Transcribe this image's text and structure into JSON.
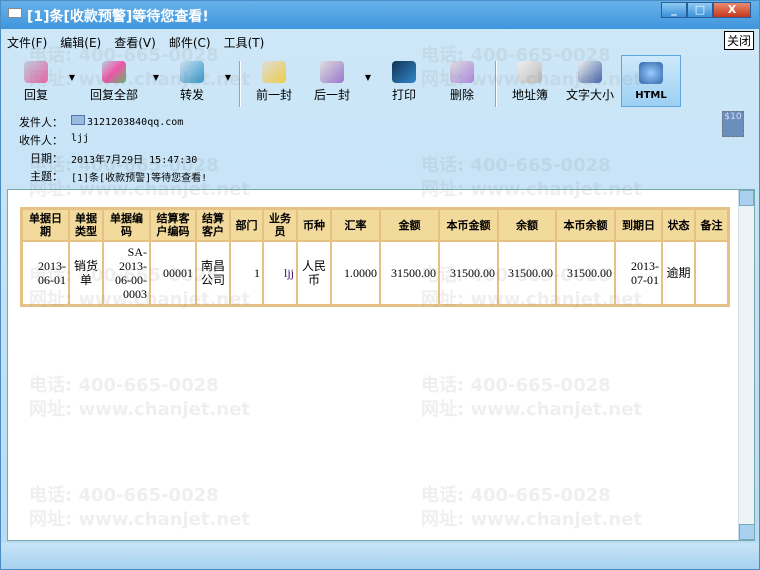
{
  "window": {
    "title": "[1]条[收款预警]等待您查看!",
    "minimize": "_",
    "maximize": "□",
    "close": "X",
    "close_tooltip": "关闭"
  },
  "menu": [
    "文件(F)",
    "编辑(E)",
    "查看(V)",
    "邮件(C)",
    "工具(T)"
  ],
  "toolbar": {
    "reply": "回复",
    "reply_all": "回复全部",
    "forward": "转发",
    "prev": "前一封",
    "next": "后一封",
    "print": "打印",
    "delete": "删除",
    "address_book": "地址簿",
    "font_size": "文字大小",
    "html": "HTML"
  },
  "header": {
    "from_label": "发件人：",
    "from": "3121203840qq.com",
    "to_label": "收件人：",
    "to": "ljj",
    "date_label": "日期：",
    "date": "2013年7月29日 15:47:30",
    "subject_label": "主题：",
    "subject": "[1]条[收款预警]等待您查看!",
    "stamp": "$10"
  },
  "table": {
    "columns": [
      "单据日期",
      "单据类型",
      "单据编码",
      "结算客户编码",
      "结算客户",
      "部门",
      "业务员",
      "币种",
      "汇率",
      "金额",
      "本币金额",
      "余额",
      "本币余额",
      "到期日",
      "状态",
      "备注"
    ],
    "rows": [
      [
        "2013-06-01",
        "销货单",
        "SA-2013-06-00-0003",
        "00001",
        "南昌公司",
        "1",
        "ljj",
        "人民币",
        "1.0000",
        "31500.00",
        "31500.00",
        "31500.00",
        "31500.00",
        "2013-07-01",
        "逾期",
        ""
      ]
    ]
  },
  "watermark": {
    "phone": "电话: 400-665-0028",
    "site": "网址: www.chanjet.net"
  },
  "colors": {
    "table_border": "#e6c186",
    "header_bg": "#f2d99c",
    "title_bar": "#3f96dc"
  }
}
